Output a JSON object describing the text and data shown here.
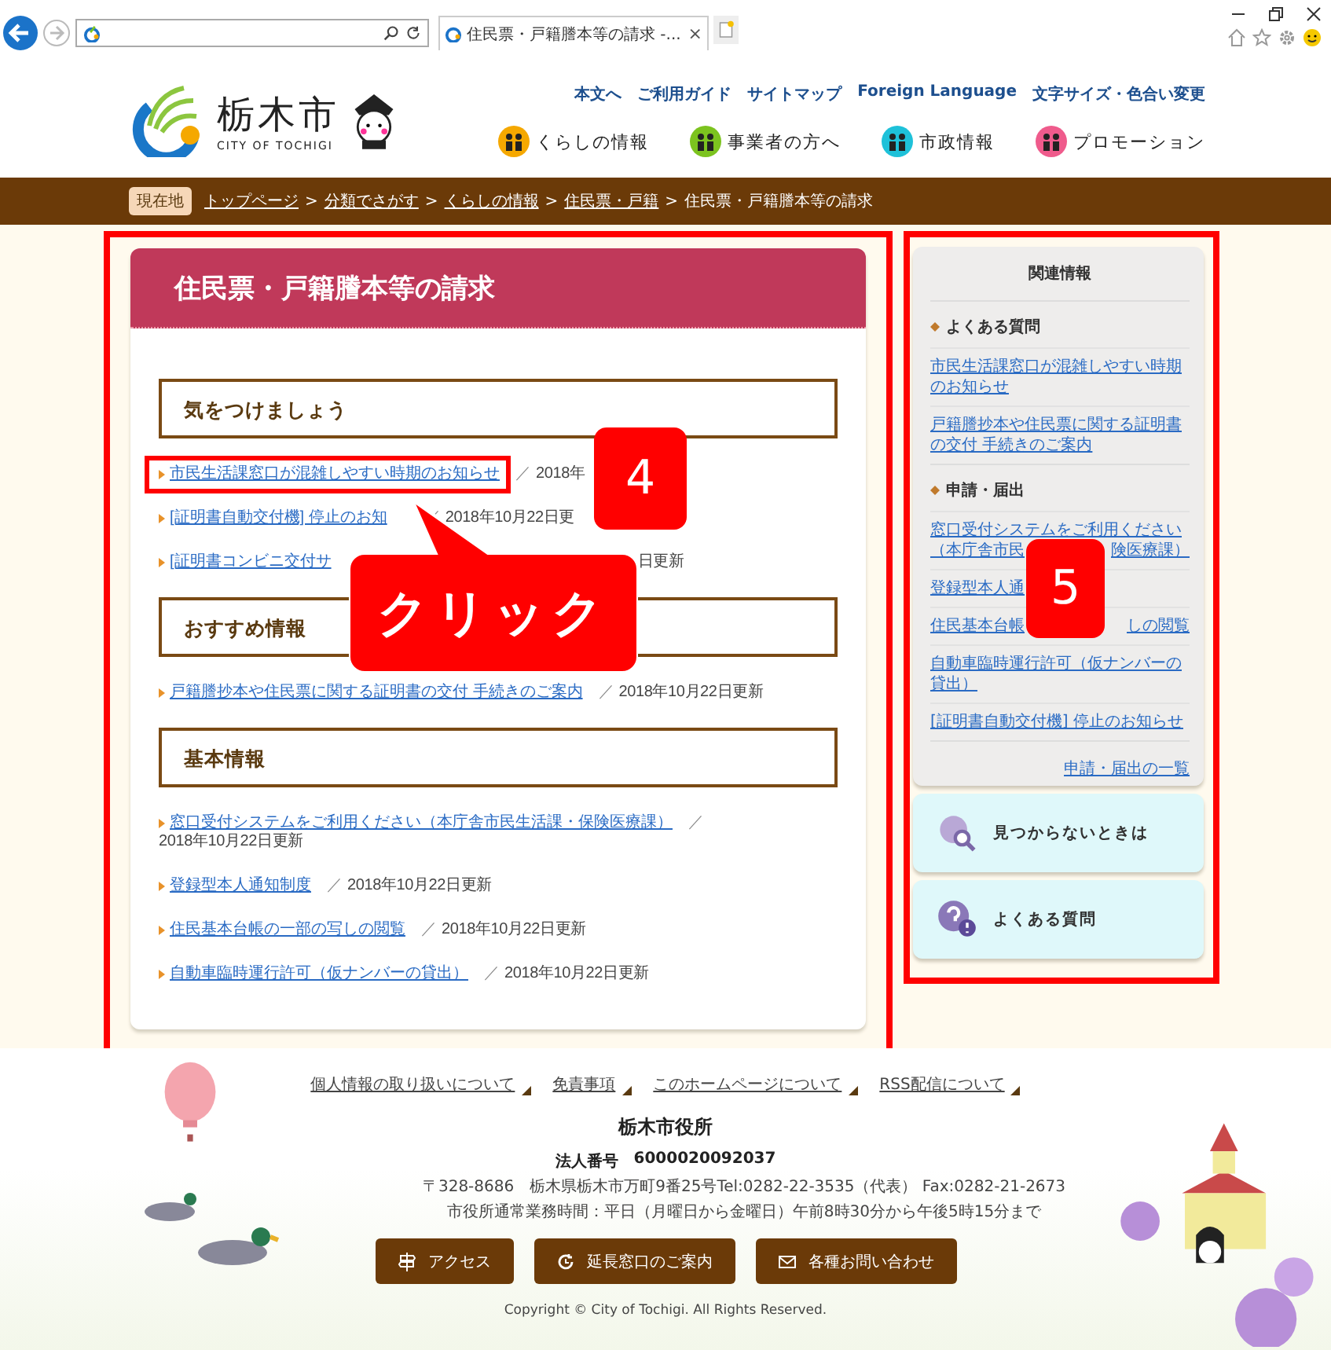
{
  "browser": {
    "tab_title": "住民票・戸籍謄本等の請求 -...",
    "tab_close": "×"
  },
  "header": {
    "logo_title": "栃木市",
    "logo_subtitle": "CITY OF TOCHIGI",
    "utility_links": [
      "本文へ",
      "ご利用ガイド",
      "サイトマップ",
      "Foreign Language",
      "文字サイズ・色合い変更"
    ],
    "nav": [
      {
        "label": "くらしの情報",
        "color": "#f5a800"
      },
      {
        "label": "事業者の方へ",
        "color": "#7cc31f"
      },
      {
        "label": "市政情報",
        "color": "#1ec1d9"
      },
      {
        "label": "プロモーション",
        "color": "#ef5b8c"
      }
    ]
  },
  "breadcrumb": {
    "badge": "現在地",
    "links": [
      "トップページ",
      "分類でさがす",
      "くらしの情報",
      "住民票・戸籍"
    ],
    "separator": ">",
    "current": "住民票・戸籍謄本等の請求"
  },
  "page_title": "住民票・戸籍謄本等の請求",
  "sections": [
    {
      "heading": "気をつけましょう",
      "items": [
        {
          "link": "市民生活課窓口が混雑しやすい時期のお知らせ",
          "date": "2018年",
          "highlighted": true
        },
        {
          "link": "[証明書自動交付機] 停止のお知",
          "date": "2018年10月22日更",
          "highlighted": false
        },
        {
          "link": "[証明書コンビニ交付サ",
          "date": "日更新",
          "highlighted": false
        }
      ]
    },
    {
      "heading": "おすすめ情報",
      "items": [
        {
          "link": "戸籍謄抄本や住民票に関する証明書の交付 手続きのご案内",
          "date": "2018年10月22日更新",
          "highlighted": false
        }
      ]
    },
    {
      "heading": "基本情報",
      "items": [
        {
          "link": "窓口受付システムをご利用ください（本庁舎市民生活課・保険医療課）",
          "date": "2018年10月22日更新",
          "highlighted": false
        },
        {
          "link": "登録型本人通知制度",
          "date": "2018年10月22日更新",
          "highlighted": false
        },
        {
          "link": "住民基本台帳の一部の写しの閲覧",
          "date": "2018年10月22日更新",
          "highlighted": false
        },
        {
          "link": "自動車臨時運行許可（仮ナンバーの貸出）",
          "date": "2018年10月22日更新",
          "highlighted": false
        }
      ]
    }
  ],
  "date_separator": "／",
  "annotations": {
    "step_main": "4",
    "callout": "クリック",
    "step_side": "5"
  },
  "sidebar": {
    "title": "関連情報",
    "groups": [
      {
        "heading": "よくある質問",
        "links": [
          {
            "text": "市民生活課窓口が混雑しやすい時期のお知らせ"
          },
          {
            "text": "戸籍謄抄本や住民票に関する証明書の交付 手続きのご案内"
          }
        ]
      },
      {
        "heading": "申請・届出",
        "links": [
          {
            "lead": "窓口受付システムをご利用ください",
            "text": "（本庁舎市民",
            "tail": "険医療課）"
          },
          {
            "text": "登録型本人通"
          },
          {
            "text": "住民基本台帳",
            "tail": "しの閲覧"
          },
          {
            "text": "自動車臨時運行許可（仮ナンバーの貸出）"
          },
          {
            "text": "[証明書自動交付機] 停止のお知らせ"
          }
        ]
      }
    ],
    "more_link": "申請・届出の一覧",
    "buttons": [
      {
        "label": "見つからないときは",
        "kind": "search"
      },
      {
        "label": "よくある質問",
        "kind": "faq"
      }
    ]
  },
  "footer": {
    "links": [
      "個人情報の取り扱いについて",
      "免責事項",
      "このホームページについて",
      "RSS配信について"
    ],
    "office": "栃木市役所",
    "corp_label": "法人番号",
    "corp_number": "6000020092037",
    "address": "〒328-8686　栃木県栃木市万町9番25号Tel:0282-22-3535（代表） Fax:0282-21-2673",
    "hours": "市役所通常業務時間：平日（月曜日から金曜日）午前8時30分から午後5時15分まで",
    "buttons": [
      {
        "label": "アクセス",
        "kind": "access"
      },
      {
        "label": "延長窓口のご案内",
        "kind": "extended"
      },
      {
        "label": "各種お問い合わせ",
        "kind": "contact"
      }
    ],
    "copyright": "Copyright © City of Tochigi. All Rights Reserved."
  }
}
